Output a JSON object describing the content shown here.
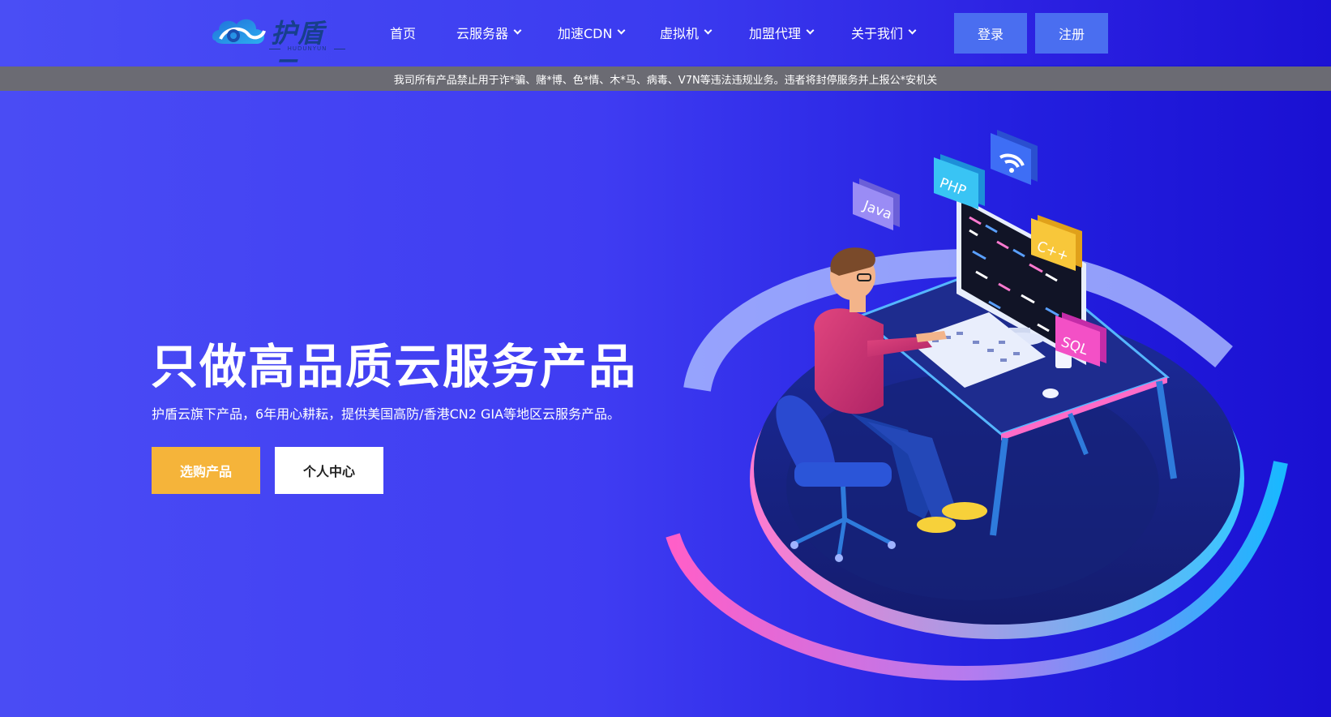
{
  "header": {
    "logo_text": "护盾云",
    "logo_sub": "HUDUNYUN",
    "nav": [
      {
        "label": "首页",
        "dropdown": false
      },
      {
        "label": "云服务器",
        "dropdown": true
      },
      {
        "label": "加速CDN",
        "dropdown": true
      },
      {
        "label": "虚拟机",
        "dropdown": true
      },
      {
        "label": "加盟代理",
        "dropdown": true
      },
      {
        "label": "关于我们",
        "dropdown": true
      }
    ],
    "login_label": "登录",
    "register_label": "注册"
  },
  "notice": "我司所有产品禁止用于诈*骗、赌*博、色*情、木*马、病毒、V7N等违法违规业务。违者将封停服务并上报公*安机关",
  "hero": {
    "title": "只做高品质云服务产品",
    "subtitle": "护盾云旗下产品，6年用心耕耘，提供美国高防/香港CN2 GIA等地区云服务产品。",
    "buy_label": "选购产品",
    "user_center_label": "个人中心"
  },
  "illustration": {
    "badges": [
      "Java",
      "PHP",
      "C++",
      "SQL"
    ],
    "wifi_icon": "wifi-icon"
  },
  "colors": {
    "accent_button": "#4a6ef0",
    "buy_button": "#f5b43a",
    "notice_bg": "#6b6b73"
  }
}
